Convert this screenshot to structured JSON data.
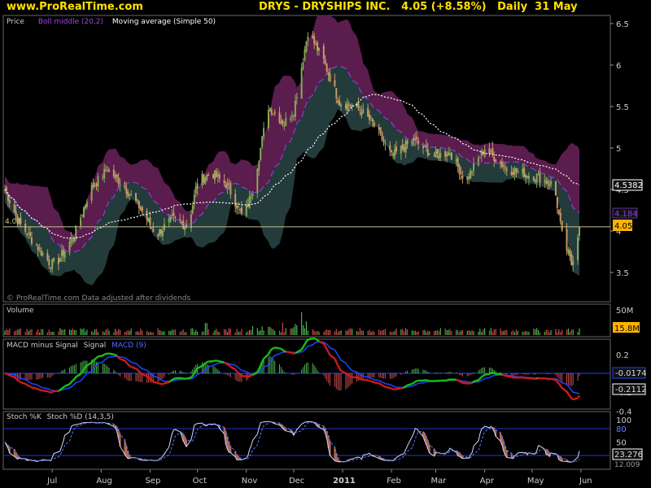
{
  "header": {
    "site": "www.ProRealTime.com",
    "title": "DRYS - DRYSHIPS INC.   4.05 (+8.58%)   Daily  31 May"
  },
  "colors": {
    "background": "#000000",
    "header_text": "#ffe100",
    "boll_upper_band": "#5a1d4d",
    "boll_lower_band": "#233b3b",
    "boll_middle": "#8a3fd4",
    "moving_average": "#ffffff",
    "candle_up": "#89a85a",
    "candle_down": "#c99a63",
    "volume_up": "#4db04d",
    "volume_down": "#c34a4a",
    "macd_line_up": "#19c019",
    "macd_line_down": "#d01b1b",
    "signal_line": "#1e46ff",
    "stoch_k": "#d7d7ff",
    "stoch_d": "#4f7bff",
    "stoch_fill": "#b76b4f",
    "price_marker": "#ffb300",
    "ma_marker": "#ffffff"
  },
  "chart_data": [
    {
      "type": "candlestick",
      "panel": "price",
      "legend": [
        "Price",
        "Boll middle (20,2)",
        "Moving average (Simple 50)"
      ],
      "yticks": [
        3.5,
        4,
        4.5,
        5,
        5.5,
        6,
        6.5
      ],
      "ylim": [
        3.2,
        6.6
      ],
      "ytick_labels": [
        "3.5",
        "4",
        "4.5",
        "5",
        "5.5",
        "6",
        "6.5"
      ],
      "last_price": "4.05",
      "ma_value": "4.5382",
      "boll_middle_value": "4.184",
      "left_price_label": "4.05",
      "watermark": "© ProRealTime.com  Data adjusted after dividends",
      "x_labels": [
        "Jul",
        "Aug",
        "Sep",
        "Oct",
        "Nov",
        "Dec",
        "2011",
        "Feb",
        "Mar",
        "Apr",
        "May",
        "Jun"
      ],
      "close_points": [
        {
          "date": "2010-06-01",
          "close": 4.5
        },
        {
          "date": "2010-06-10",
          "close": 4.1
        },
        {
          "date": "2010-06-20",
          "close": 3.85
        },
        {
          "date": "2010-06-30",
          "close": 3.6
        },
        {
          "date": "2010-07-05",
          "close": 3.65
        },
        {
          "date": "2010-07-15",
          "close": 3.95
        },
        {
          "date": "2010-07-25",
          "close": 4.5
        },
        {
          "date": "2010-08-05",
          "close": 4.75
        },
        {
          "date": "2010-08-15",
          "close": 4.55
        },
        {
          "date": "2010-08-25",
          "close": 4.3
        },
        {
          "date": "2010-09-05",
          "close": 3.95
        },
        {
          "date": "2010-09-15",
          "close": 4.15
        },
        {
          "date": "2010-09-25",
          "close": 4.05
        },
        {
          "date": "2010-10-01",
          "close": 4.6
        },
        {
          "date": "2010-10-10",
          "close": 4.7
        },
        {
          "date": "2010-10-20",
          "close": 4.55
        },
        {
          "date": "2010-10-30",
          "close": 4.15
        },
        {
          "date": "2010-11-05",
          "close": 4.5
        },
        {
          "date": "2010-11-15",
          "close": 5.5
        },
        {
          "date": "2010-11-25",
          "close": 5.3
        },
        {
          "date": "2010-12-01",
          "close": 5.45
        },
        {
          "date": "2010-12-10",
          "close": 6.4
        },
        {
          "date": "2010-12-20",
          "close": 6.05
        },
        {
          "date": "2010-12-30",
          "close": 5.55
        },
        {
          "date": "2011-01-10",
          "close": 5.5
        },
        {
          "date": "2011-01-20",
          "close": 5.3
        },
        {
          "date": "2011-02-01",
          "close": 4.9
        },
        {
          "date": "2011-02-15",
          "close": 5.1
        },
        {
          "date": "2011-02-28",
          "close": 4.9
        },
        {
          "date": "2011-03-10",
          "close": 4.95
        },
        {
          "date": "2011-03-20",
          "close": 4.6
        },
        {
          "date": "2011-04-01",
          "close": 5.0
        },
        {
          "date": "2011-04-15",
          "close": 4.75
        },
        {
          "date": "2011-04-25",
          "close": 4.7
        },
        {
          "date": "2011-05-05",
          "close": 4.65
        },
        {
          "date": "2011-05-15",
          "close": 4.55
        },
        {
          "date": "2011-05-20",
          "close": 3.95
        },
        {
          "date": "2011-05-26",
          "close": 3.6
        },
        {
          "date": "2011-05-31",
          "close": 4.05
        }
      ]
    },
    {
      "type": "bar",
      "panel": "volume",
      "legend": [
        "Volume"
      ],
      "yticks": [
        "50M"
      ],
      "last_value": "15.8M",
      "note": "daily volume bars, peak about 52M in early December"
    },
    {
      "type": "histogram",
      "panel": "macd",
      "legend": [
        "MACD minus Signal",
        "Signal",
        "MACD (9)"
      ],
      "yticks": [
        0.2,
        0,
        -0.2,
        -0.4
      ],
      "ytick_labels": [
        "0.2",
        "0",
        "-0.2",
        "-0.4"
      ],
      "signal_value": "-0.0174",
      "macd_value": "-0.2112"
    },
    {
      "type": "line",
      "panel": "stochastic",
      "legend": [
        "Stoch %K",
        "Stoch %D (14,3,5)"
      ],
      "yticks": [
        100,
        80,
        50,
        20
      ],
      "ytick_labels": [
        "100",
        "80",
        "50",
        "20"
      ],
      "k_value": "23.276",
      "d_value": "12.009",
      "upper_level": 80,
      "lower_level": 20
    }
  ]
}
